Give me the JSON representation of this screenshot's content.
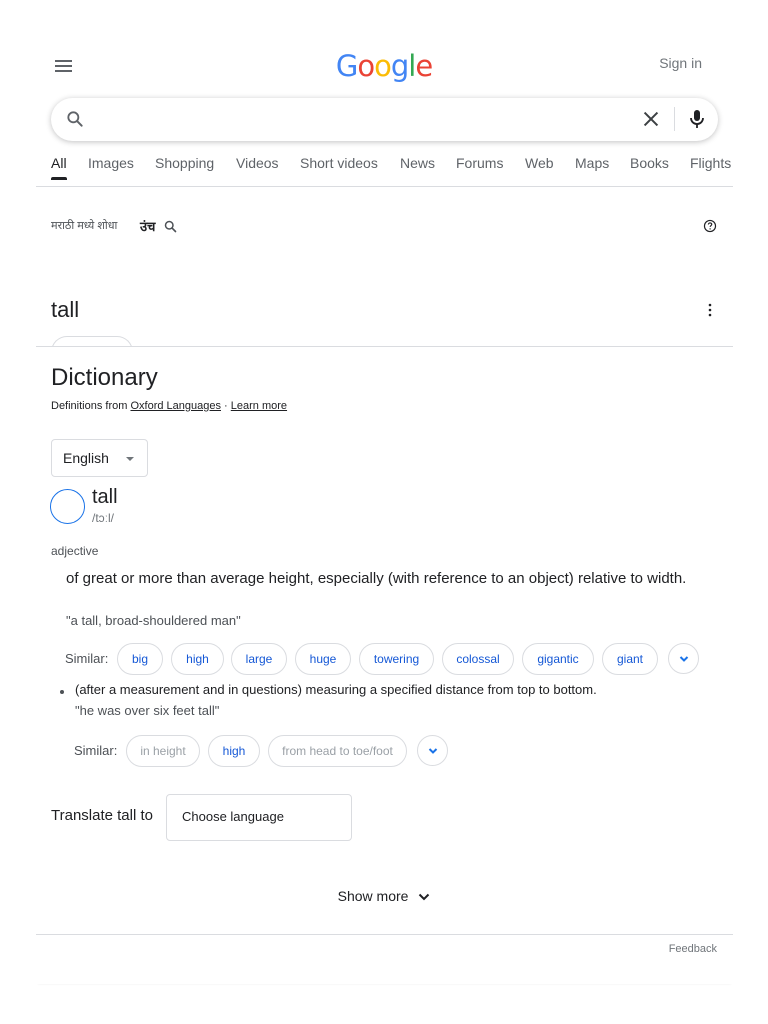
{
  "header": {
    "logo_letters": [
      {
        "ch": "G",
        "color": "#4285F4"
      },
      {
        "ch": "o",
        "color": "#EA4335"
      },
      {
        "ch": "o",
        "color": "#FBBC05"
      },
      {
        "ch": "g",
        "color": "#4285F4"
      },
      {
        "ch": "l",
        "color": "#34A853"
      },
      {
        "ch": "e",
        "color": "#EA4335"
      }
    ],
    "sign_in": "Sign in",
    "menu_icon": "hamburger-menu-icon"
  },
  "search": {
    "value": "",
    "placeholder": "",
    "icons": [
      "search-icon",
      "clear-icon",
      "microphone-icon"
    ]
  },
  "tabs": [
    {
      "label": "All",
      "active": true
    },
    {
      "label": "Images"
    },
    {
      "label": "Shopping"
    },
    {
      "label": "Videos"
    },
    {
      "label": "Short videos"
    },
    {
      "label": "News"
    },
    {
      "label": "Forums"
    },
    {
      "label": "Web"
    },
    {
      "label": "Maps"
    },
    {
      "label": "Books"
    },
    {
      "label": "Flights"
    }
  ],
  "marathi": {
    "prompt": "मराठी मध्ये शोधा",
    "query": "उंच"
  },
  "query": {
    "title": "tall"
  },
  "dictionary": {
    "title": "Dictionary",
    "source_prefix": "Definitions from ",
    "source_link": "Oxford Languages",
    "separator": " · ",
    "learn_more": "Learn more",
    "language": "English",
    "word": "tall",
    "phonetic": "/tɔːl/",
    "part_of_speech": "adjective",
    "senses": [
      {
        "definition": "of great or more than average height, especially (with reference to an object) relative to width.",
        "example": "\"a tall, broad-shouldered man\"",
        "similar_label": "Similar:",
        "similar": [
          "big",
          "high",
          "large",
          "huge",
          "towering",
          "colossal",
          "gigantic",
          "giant"
        ]
      },
      {
        "definition": "(after a measurement and in questions) measuring a specified distance from top to bottom.",
        "example": "\"he was over six feet tall\"",
        "similar_label": "Similar:",
        "similar": [
          "in height",
          "high",
          "from head to toe/foot"
        ],
        "similar_active": [
          false,
          true,
          false
        ]
      }
    ]
  },
  "translate": {
    "label": "Translate tall to",
    "placeholder": "Choose language"
  },
  "show_more": "Show more",
  "feedback": "Feedback",
  "colors": {
    "link_blue": "#1558d6",
    "accent_blue": "#1a73e8",
    "text_grey": "#70757a"
  }
}
